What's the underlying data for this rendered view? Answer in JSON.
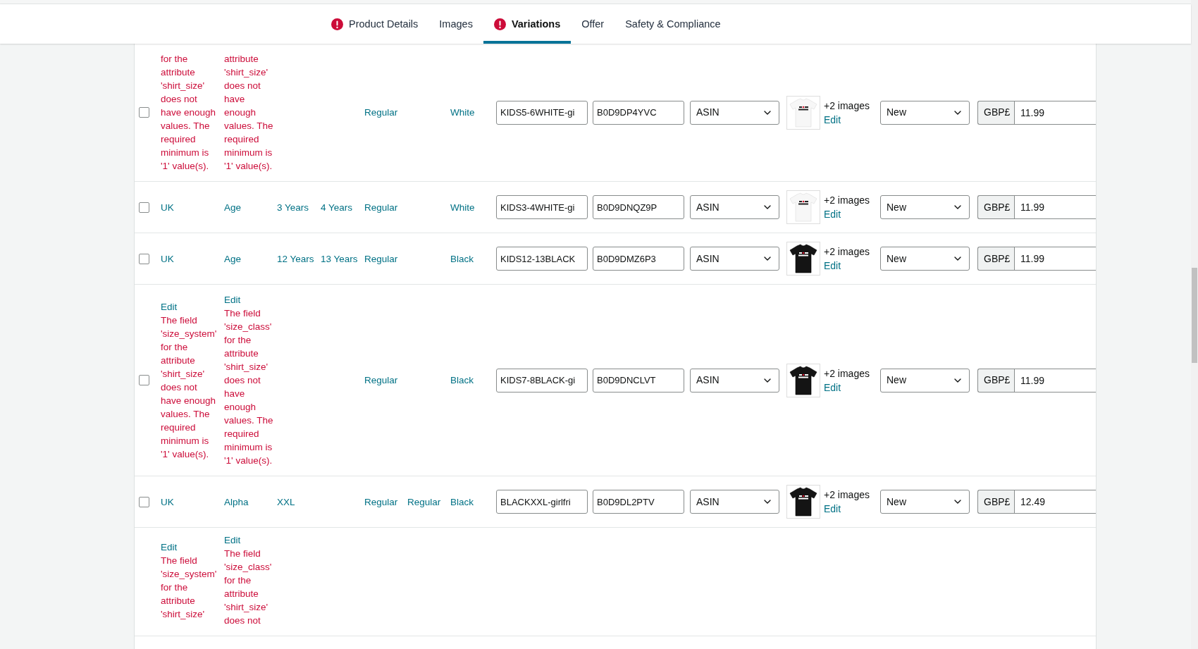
{
  "tabs": [
    {
      "label": "Product Details",
      "selected": false,
      "error": true
    },
    {
      "label": "Images",
      "selected": false,
      "error": false
    },
    {
      "label": "Variations",
      "selected": true,
      "error": true
    },
    {
      "label": "Offer",
      "selected": false,
      "error": false
    },
    {
      "label": "Safety & Compliance",
      "selected": false,
      "error": false
    }
  ],
  "rows": [
    {
      "checked": false,
      "cells": [
        {
          "kind": "error",
          "message": "for the attribute 'shirt_size' does not have enough values. The required minimum is '1' value(s)."
        },
        {
          "kind": "error",
          "message": "attribute 'shirt_size' does not have enough values. The required minimum is '1' value(s)."
        },
        {
          "kind": "blank"
        },
        {
          "kind": "blank"
        },
        {
          "kind": "link",
          "text": "Regular"
        },
        {
          "kind": "blank"
        },
        {
          "kind": "link",
          "text": "White"
        }
      ],
      "sku": "KIDS5-6WHITE-gi",
      "product_id": "B0D9DP4YVC",
      "id_type": "ASIN",
      "image": {
        "kind": "picture",
        "dark_shirt": false
      },
      "image_count": "+2 images",
      "image_edit": "Edit",
      "condition": "New",
      "currency": "GBP£",
      "price": "11.99"
    },
    {
      "checked": false,
      "cells": [
        {
          "kind": "link",
          "text": "UK"
        },
        {
          "kind": "link",
          "text": "Age"
        },
        {
          "kind": "link",
          "text": "3 Years"
        },
        {
          "kind": "link",
          "text": "4 Years"
        },
        {
          "kind": "link",
          "text": "Regular"
        },
        {
          "kind": "blank"
        },
        {
          "kind": "link",
          "text": "White"
        }
      ],
      "sku": "KIDS3-4WHITE-gi",
      "product_id": "B0D9DNQZ9P",
      "id_type": "ASIN",
      "image": {
        "kind": "picture",
        "dark_shirt": false
      },
      "image_count": "+2 images",
      "image_edit": "Edit",
      "condition": "New",
      "currency": "GBP£",
      "price": "11.99"
    },
    {
      "checked": false,
      "cells": [
        {
          "kind": "link",
          "text": "UK"
        },
        {
          "kind": "link",
          "text": "Age"
        },
        {
          "kind": "link",
          "text": "12 Years"
        },
        {
          "kind": "link",
          "text": "13 Years"
        },
        {
          "kind": "link",
          "text": "Regular"
        },
        {
          "kind": "blank"
        },
        {
          "kind": "link",
          "text": "Black"
        }
      ],
      "sku": "KIDS12-13BLACK",
      "product_id": "B0D9DMZ6P3",
      "id_type": "ASIN",
      "image": {
        "kind": "picture",
        "dark_shirt": true
      },
      "image_count": "+2 images",
      "image_edit": "Edit",
      "condition": "New",
      "currency": "GBP£",
      "price": "11.99"
    },
    {
      "checked": false,
      "cells": [
        {
          "kind": "error",
          "edit": "Edit",
          "message": "The field 'size_system' for the attribute 'shirt_size' does not have enough values. The required minimum is '1' value(s)."
        },
        {
          "kind": "error",
          "edit": "Edit",
          "message": "The field 'size_class' for the attribute 'shirt_size' does not have enough values. The required minimum is '1' value(s)."
        },
        {
          "kind": "blank"
        },
        {
          "kind": "blank"
        },
        {
          "kind": "link",
          "text": "Regular"
        },
        {
          "kind": "blank"
        },
        {
          "kind": "link",
          "text": "Black"
        }
      ],
      "sku": "KIDS7-8BLACK-gi",
      "product_id": "B0D9DNCLVT",
      "id_type": "ASIN",
      "image": {
        "kind": "picture",
        "dark_shirt": true
      },
      "image_count": "+2 images",
      "image_edit": "Edit",
      "condition": "New",
      "currency": "GBP£",
      "price": "11.99"
    },
    {
      "checked": false,
      "cells": [
        {
          "kind": "link",
          "text": "UK"
        },
        {
          "kind": "link",
          "text": "Alpha"
        },
        {
          "kind": "link",
          "text": "XXL"
        },
        {
          "kind": "blank"
        },
        {
          "kind": "link",
          "text": "Regular"
        },
        {
          "kind": "link",
          "text": "Regular"
        },
        {
          "kind": "link",
          "text": "Black"
        }
      ],
      "sku": "BLACKXXL-girlfri",
      "product_id": "B0D9DL2PTV",
      "id_type": "ASIN",
      "image": {
        "kind": "picture",
        "dark_shirt": true
      },
      "image_count": "+2 images",
      "image_edit": "Edit",
      "condition": "New",
      "currency": "GBP£",
      "price": "12.49"
    },
    {
      "cells": [
        {
          "kind": "error",
          "edit": "Edit",
          "message": "The field 'size_system' for the attribute 'shirt_size'"
        },
        {
          "kind": "error",
          "edit": "Edit",
          "message": "The field 'size_class' for the attribute 'shirt_size' does not"
        }
      ]
    }
  ]
}
